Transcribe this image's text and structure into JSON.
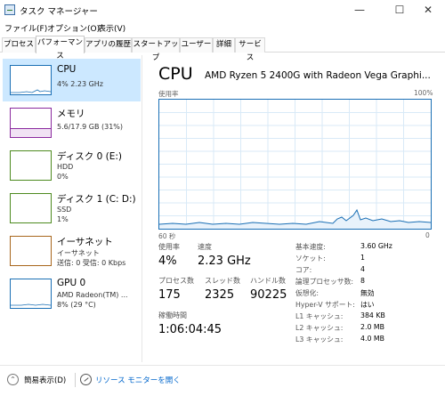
{
  "window": {
    "title": "タスク マネージャー",
    "controls": {
      "minimize": "—",
      "maximize": "☐",
      "close": "✕"
    }
  },
  "menu": [
    "ファイル(F)",
    "オプション(O)",
    "表示(V)"
  ],
  "tabs": [
    "プロセス",
    "パフォーマンス",
    "アプリの履歴",
    "スタートアップ",
    "ユーザー",
    "詳細",
    "サービス"
  ],
  "active_tab": "パフォーマンス",
  "sidebar": [
    {
      "name": "CPU",
      "lines": [
        "4% 2.23 GHz"
      ],
      "color": "#1a6fb5",
      "selected": true
    },
    {
      "name": "メモリ",
      "lines": [
        "5.6/17.9 GB (31%)"
      ],
      "color": "#8b2a9e",
      "selected": false
    },
    {
      "name": "ディスク 0 (E:)",
      "lines": [
        "HDD",
        "0%"
      ],
      "color": "#4d8a1f",
      "selected": false
    },
    {
      "name": "ディスク 1 (C: D:)",
      "lines": [
        "SSD",
        "1%"
      ],
      "color": "#4d8a1f",
      "selected": false
    },
    {
      "name": "イーサネット",
      "lines": [
        "イーサネット",
        "送信: 0 受信: 0 Kbps"
      ],
      "color": "#a8661c",
      "selected": false
    },
    {
      "name": "GPU 0",
      "lines": [
        "AMD Radeon(TM) ...",
        "8% (29 °C)"
      ],
      "color": "#1a6fb5",
      "selected": false
    }
  ],
  "main": {
    "title": "CPU",
    "model": "AMD Ryzen 5 2400G with Radeon Vega Graphi...",
    "graph_label_top_left": "使用率",
    "graph_label_top_right": "100%",
    "graph_label_bottom_left": "60 秒",
    "graph_label_bottom_right": "0",
    "accent_color": "#1a6fb5",
    "usage": {
      "label": "使用率",
      "value": "4%"
    },
    "speed": {
      "label": "速度",
      "value": "2.23 GHz"
    },
    "processes": {
      "label": "プロセス数",
      "value": "175"
    },
    "threads": {
      "label": "スレッド数",
      "value": "2325"
    },
    "handles": {
      "label": "ハンドル数",
      "value": "90225"
    },
    "uptime": {
      "label": "稼働時間",
      "value": "1:06:04:45"
    },
    "specs": [
      {
        "label": "基本速度:",
        "value": "3.60 GHz"
      },
      {
        "label": "ソケット:",
        "value": "1"
      },
      {
        "label": "コア:",
        "value": "4"
      },
      {
        "label": "論理プロセッサ数:",
        "value": "8"
      },
      {
        "label": "仮想化:",
        "value": "無効"
      },
      {
        "label": "Hyper-V サポート:",
        "value": "はい"
      },
      {
        "label": "L1 キャッシュ:",
        "value": "384 KB"
      },
      {
        "label": "L2 キャッシュ:",
        "value": "2.0 MB"
      },
      {
        "label": "L3 キャッシュ:",
        "value": "4.0 MB"
      }
    ]
  },
  "footer": {
    "fewer_details": "簡易表示(D)",
    "resource_monitor": "リソース モニターを開く"
  }
}
